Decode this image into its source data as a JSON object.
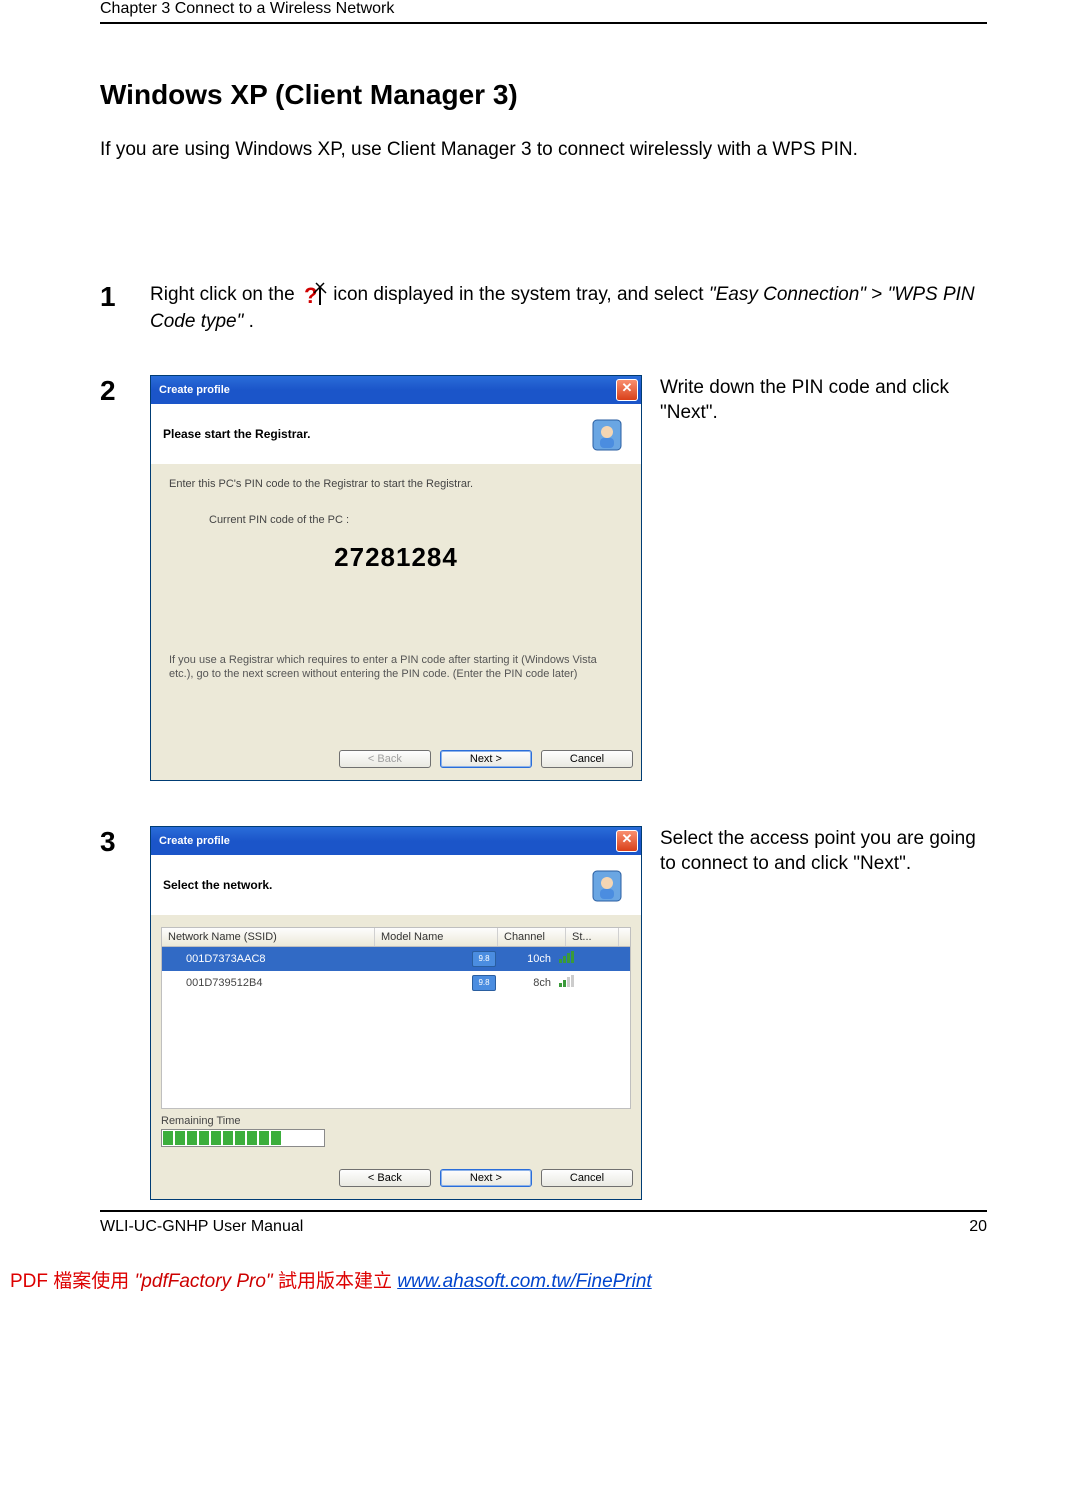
{
  "header": {
    "chapter": "Chapter 3  Connect to a Wireless Network"
  },
  "section": {
    "title": "Windows XP (Client Manager 3)",
    "intro": "If you are using Windows XP, use Client Manager 3 to connect wirelessly with a WPS PIN."
  },
  "step1": {
    "num": "1",
    "pre": "Right click on the ",
    "post": " icon displayed in the system tray, and select ",
    "menu1": "\"Easy Connection\"",
    "sep": " > ",
    "menu2": "\"WPS PIN Code type\"",
    "end": "."
  },
  "step2": {
    "num": "2",
    "side": "Write down the PIN code and click \"Next\".",
    "dialog": {
      "title": "Create profile",
      "sub": "Please start the Registrar.",
      "line1": "Enter this PC's PIN code to the Registrar to start the Registrar.",
      "label": "Current PIN code of the PC :",
      "pin": "27281284",
      "note": "If you use a Registrar which requires to enter a PIN code after starting it (Windows Vista etc.), go to the next screen without entering the PIN code. (Enter the PIN code later)",
      "back": "< Back",
      "next": "Next >",
      "cancel": "Cancel"
    }
  },
  "step3": {
    "num": "3",
    "side": "Select the access point you are going to connect to and click \"Next\".",
    "dialog": {
      "title": "Create profile",
      "sub": "Select the network.",
      "cols": {
        "ssid": "Network Name (SSID)",
        "model": "Model Name",
        "chan": "Channel",
        "str": "St..."
      },
      "rows": [
        {
          "ssid": "001D7373AAC8",
          "chan": "10ch",
          "model": "9.8"
        },
        {
          "ssid": "001D739512B4",
          "chan": "8ch",
          "model": "9.8"
        }
      ],
      "remaining": "Remaining Time",
      "back": "< Back",
      "next": "Next >",
      "cancel": "Cancel"
    }
  },
  "footer": {
    "left": "WLI-UC-GNHP User Manual",
    "right": "20"
  },
  "watermark": {
    "t1": "PDF 檔案使用 ",
    "t2": "\"pdfFactory Pro\"",
    "t3": " 試用版本建立 ",
    "link": "www.ahasoft.com.tw/FinePrint"
  }
}
